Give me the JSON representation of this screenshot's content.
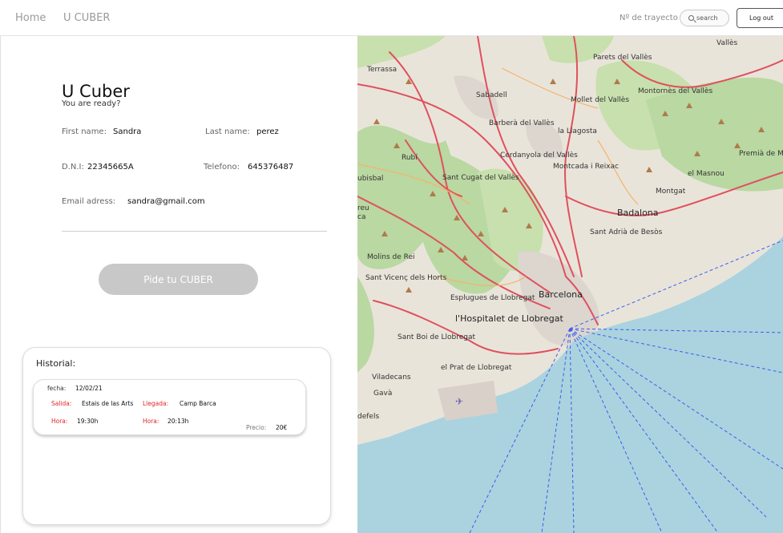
{
  "nav": {
    "home": "Home",
    "app": "U CUBER",
    "trayecto_label": "Nº de trayecto",
    "search_placeholder": "search",
    "logout": "Log out"
  },
  "profile": {
    "title": "U Cuber",
    "subtitle": "You are ready?",
    "first_name_label": "First name:",
    "first_name": "Sandra",
    "last_name_label": "Last name:",
    "last_name": "perez",
    "dni_label": "D.N.I:",
    "dni": "22345665A",
    "telefono_label": "Telefono:",
    "telefono": "645376487",
    "email_label": "Email adress:",
    "email": "sandra@gmail.com"
  },
  "cta": {
    "label": "Pide tu CUBER"
  },
  "historial": {
    "title": "Historial:",
    "trip": {
      "fecha_label": "fecha:",
      "fecha": "12/02/21",
      "salida_label": "Salida:",
      "salida": "Estais de las Arts",
      "llegada_label": "Llegada:",
      "llegada": "Camp Barca",
      "hora_label": "Hora:",
      "hora_salida": "19:30h",
      "hora_llegada": "20:13h",
      "precio_label": "Precio:",
      "precio": "20€"
    }
  },
  "map": {
    "labels": [
      "Terrassa",
      "Sabadell",
      "Parets del Vallès",
      "Mollet del Vallès",
      "Montornès del Vallès",
      "Barberà del Vallès",
      "la Llagosta",
      "Cerdanyola del Vallès",
      "Montcada i Reixac",
      "Rubí",
      "Sant Cugat del Vallès",
      "el Masnou",
      "Montgat",
      "Badalona",
      "Premià de Mar",
      "Sant Adrià de Besòs",
      "Molins de Rei",
      "Sant Vicenç dels Horts",
      "Esplugues de Llobregat",
      "Barcelona",
      "l'Hospitalet de Llobregat",
      "Sant Boi de Llobregat",
      "el Prat de Llobregat",
      "Viladecans",
      "Gavà",
      "defels",
      "Vallès",
      "ubisbal",
      "reu",
      "ca"
    ],
    "colors": {
      "land": "#e9e4da",
      "forest": "#b9d8a2",
      "sea": "#aad3df",
      "road": "#e0505e",
      "route": "#3b5ef0"
    }
  }
}
